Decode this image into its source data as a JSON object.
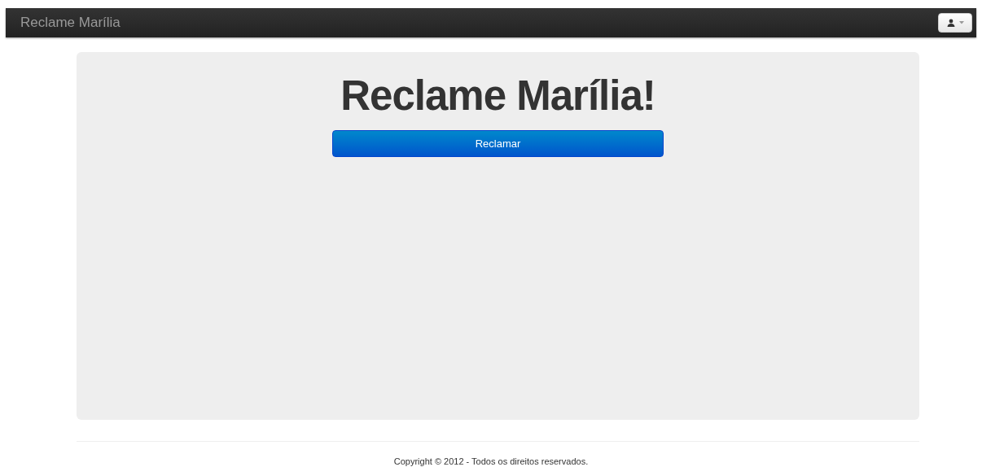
{
  "navbar": {
    "brand": "Reclame Marília"
  },
  "hero": {
    "title": "Reclame Marília!",
    "button": "Reclamar"
  },
  "footer": {
    "text": "Copyright © 2012 - Todos os direitos reservados."
  }
}
